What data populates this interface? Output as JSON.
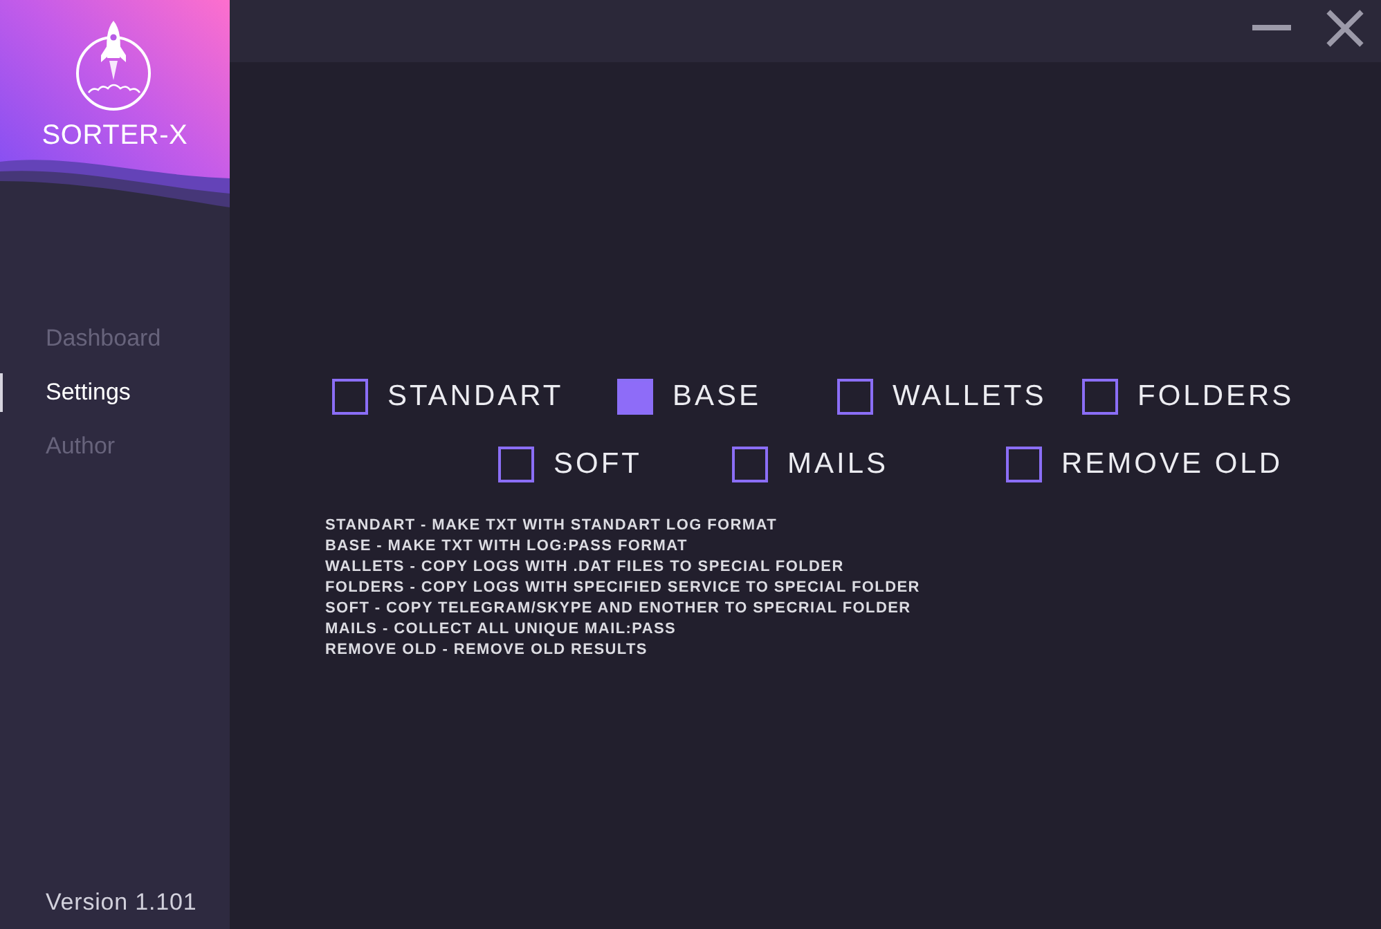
{
  "app": {
    "name": "SORTER-X",
    "version": "Version 1.101"
  },
  "sidebar": {
    "items": [
      {
        "label": "Dashboard",
        "selected": false
      },
      {
        "label": "Settings",
        "selected": true
      },
      {
        "label": "Author",
        "selected": false
      }
    ]
  },
  "option_rows": [
    {
      "options": [
        {
          "label": "STANDART",
          "checked": false
        },
        {
          "label": "BASE",
          "checked": true
        },
        {
          "label": "WALLETS",
          "checked": false
        },
        {
          "label": "FOLDERS",
          "checked": false
        }
      ]
    },
    {
      "options": [
        {
          "label": "SOFT",
          "checked": false
        },
        {
          "label": "MAILS",
          "checked": false
        },
        {
          "label": "REMOVE OLD",
          "checked": false
        }
      ]
    }
  ],
  "descriptions": [
    "STANDART - MAKE TXT WITH STANDART LOG FORMAT",
    "BASE - MAKE TXT WITH LOG:PASS FORMAT",
    "WALLETS - COPY LOGS WITH .DAT FILES TO SPECIAL FOLDER",
    "FOLDERS - COPY LOGS WITH SPECIFIED SERVICE TO SPECIAL FOLDER",
    "SOFT - COPY TELEGRAM/SKYPE AND ENOTHER TO SPECRIAL FOLDER",
    "MAILS - COLLECT ALL UNIQUE MAIL:PASS",
    "REMOVE OLD - REMOVE OLD RESULTS"
  ]
}
